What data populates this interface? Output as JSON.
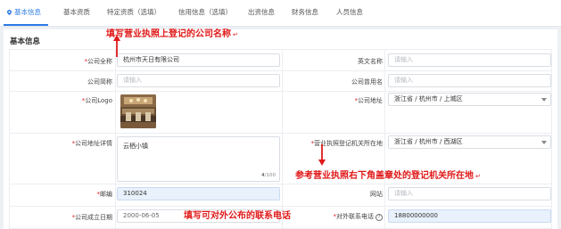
{
  "tabs": [
    {
      "label": "基本信息",
      "active": true
    },
    {
      "label": "基本资质",
      "active": false
    },
    {
      "label": "特定资质（选填）",
      "active": false
    },
    {
      "label": "信用信息（选填）",
      "active": false
    },
    {
      "label": "出资信息",
      "active": false
    },
    {
      "label": "财务信息",
      "active": false
    },
    {
      "label": "人员信息",
      "active": false
    }
  ],
  "section_title": "基本信息",
  "form": {
    "company_full_name": {
      "label": "*公司全称",
      "value": "杭州市天日有限公司"
    },
    "english_name": {
      "label": "英文名称",
      "placeholder": "请输入"
    },
    "company_short_name": {
      "label": "公司简称",
      "placeholder": "请输入"
    },
    "company_former_name": {
      "label": "公司曾用名",
      "placeholder": "请输入"
    },
    "company_logo": {
      "label": "*公司Logo"
    },
    "company_address": {
      "label": "*公司地址",
      "value": "浙江省 / 杭州市 / 上城区"
    },
    "address_detail": {
      "label": "*公司地址详情",
      "value": "云栖小镇",
      "count": "4",
      "max": "/100"
    },
    "registration_authority": {
      "label": "*营业执照登记机关所在地",
      "value": "浙江省 / 杭州市 / 西湖区"
    },
    "postal_code": {
      "label": "*邮编",
      "value": "310024"
    },
    "website": {
      "label": "网站",
      "placeholder": "请输入"
    },
    "established_date": {
      "label": "*公司成立日期",
      "value": "2000-06-05"
    },
    "contact_phone": {
      "label": "*对外联系电话",
      "help": "?",
      "value": "18800000000"
    }
  },
  "annotations": {
    "company_name_tip": "填写营业执照上登记的公司名称",
    "authority_tip": "参考营业执照右下角盖章处的登记机关所在地",
    "phone_tip": "填写可对外公布的联系电话",
    "return_mark": "↵"
  },
  "colors": {
    "accent": "#2d7be5",
    "annotation": "#e01919",
    "required": "#e02020"
  }
}
